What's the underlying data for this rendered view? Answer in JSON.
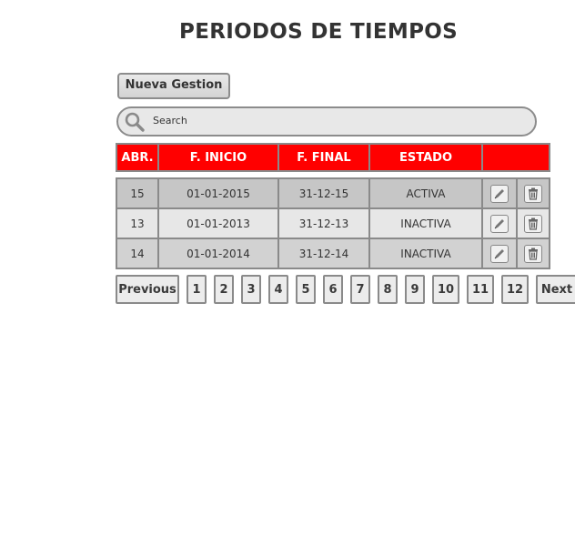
{
  "page": {
    "title": "PERIODOS DE TIEMPOS"
  },
  "toolbar": {
    "new_label": "Nueva Gestion"
  },
  "search": {
    "placeholder": "Search",
    "icon": "search-icon"
  },
  "table": {
    "header_color": "#ff0000",
    "columns": [
      "ABR.",
      "F. INICIO",
      "F. FINAL",
      "ESTADO",
      ""
    ],
    "rows": [
      {
        "abr": "15",
        "inicio": "01-01-2015",
        "final": "31-12-15",
        "estado": "ACTIVA"
      },
      {
        "abr": "13",
        "inicio": "01-01-2013",
        "final": "31-12-13",
        "estado": "INACTIVA"
      },
      {
        "abr": "14",
        "inicio": "01-01-2014",
        "final": "31-12-14",
        "estado": "INACTIVA"
      }
    ],
    "row_icons": [
      "edit-icon",
      "trash-icon"
    ]
  },
  "pagination": {
    "previous": "Previous",
    "next": "Next",
    "pages": [
      "1",
      "2",
      "3",
      "4",
      "5",
      "6",
      "7",
      "8",
      "9",
      "10",
      "11",
      "12"
    ]
  }
}
